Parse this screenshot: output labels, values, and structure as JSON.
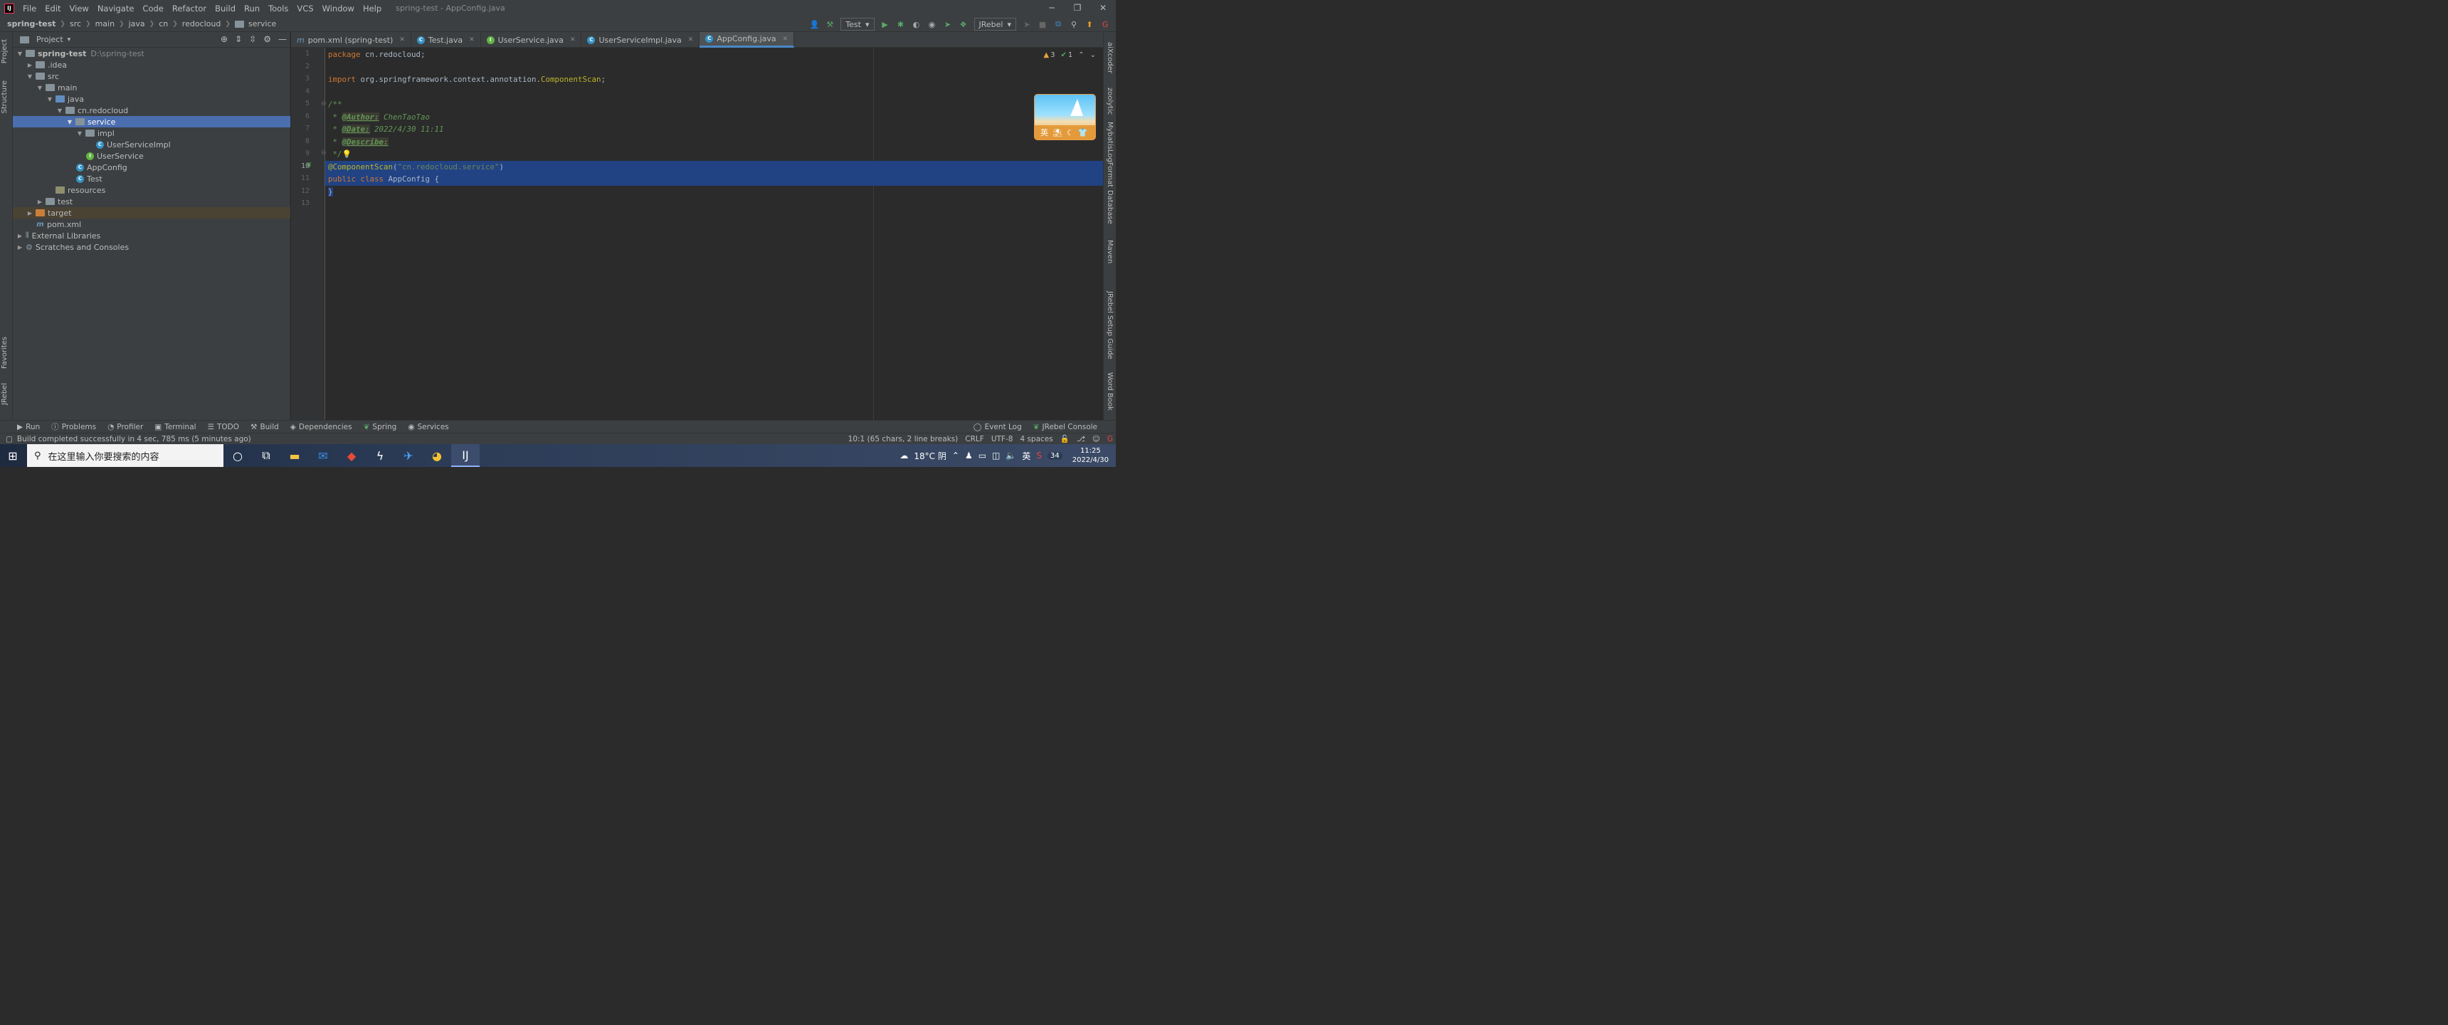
{
  "menubar": {
    "items": [
      "File",
      "Edit",
      "View",
      "Navigate",
      "Code",
      "Refactor",
      "Build",
      "Run",
      "Tools",
      "VCS",
      "Window",
      "Help"
    ],
    "title": "spring-test - AppConfig.java"
  },
  "navbar": {
    "crumbs": [
      "spring-test",
      "src",
      "main",
      "java",
      "cn",
      "redocloud",
      "service"
    ],
    "run_config": "Test",
    "jrebel_combo": "JRebel"
  },
  "left_strip": {
    "project": "Project",
    "structure": "Structure",
    "favorites": "Favorites",
    "jrebel": "JRebel"
  },
  "right_strip": {
    "aixcoder": "aiXcoder",
    "zoolytic": "zoolytic",
    "mybatis": "MybatisLogFormat",
    "database": "Database",
    "maven": "Maven",
    "jrebel_guide": "JRebel Setup Guide",
    "word_book": "Word Book"
  },
  "project": {
    "title": "Project",
    "tree": [
      {
        "label": "spring-test",
        "path": "D:\\spring-test",
        "bold": true
      },
      {
        "label": ".idea"
      },
      {
        "label": "src"
      },
      {
        "label": "main"
      },
      {
        "label": "java"
      },
      {
        "label": "cn.redocloud"
      },
      {
        "label": "service"
      },
      {
        "label": "impl"
      },
      {
        "label": "UserServiceImpl"
      },
      {
        "label": "UserService"
      },
      {
        "label": "AppConfig"
      },
      {
        "label": "Test"
      },
      {
        "label": "resources"
      },
      {
        "label": "test"
      },
      {
        "label": "target"
      },
      {
        "label": "pom.xml"
      },
      {
        "label": "External Libraries"
      },
      {
        "label": "Scratches and Consoles"
      }
    ]
  },
  "tabs": [
    {
      "label": "pom.xml (spring-test)",
      "icon": "m"
    },
    {
      "label": "Test.java",
      "icon": "c"
    },
    {
      "label": "UserService.java",
      "icon": "i"
    },
    {
      "label": "UserServiceImpl.java",
      "icon": "c"
    },
    {
      "label": "AppConfig.java",
      "icon": "c",
      "active": true
    }
  ],
  "editor": {
    "line_numbers": [
      "1",
      "2",
      "3",
      "4",
      "5",
      "6",
      "7",
      "8",
      "9",
      "10",
      "11",
      "12",
      "13"
    ],
    "pkg_kw": "package",
    "pkg_name": " cn.redocloud;",
    "imp_kw": "import",
    "imp_pkg": " org.springframework.context.annotation.",
    "imp_cls": "ComponentScan",
    "imp_end": ";",
    "doc_open": "/**",
    "doc_star": " * ",
    "author_tag": "@Author:",
    "author_val": " ChenTaoTao",
    "date_tag": "@Date:",
    "date_val": " 2022/4/30 11:11",
    "desc_tag": "@Describe:",
    "doc_close": " */",
    "ann_name": "@ComponentScan",
    "ann_arg": "\"cn.redocloud.service\"",
    "class_kw": "public class",
    "class_name": " AppConfig {",
    "close_brace": "}",
    "warnings": "3",
    "weak_warnings": "1"
  },
  "image_widget": {
    "label": "英"
  },
  "bottom_tools": [
    "Run",
    "Problems",
    "Profiler",
    "Terminal",
    "TODO",
    "Build",
    "Dependencies",
    "Spring",
    "Services"
  ],
  "bottom_right": [
    "Event Log",
    "JRebel Console"
  ],
  "status": {
    "message": "Build completed successfully in 4 sec, 785 ms (5 minutes ago)",
    "position": "10:1 (65 chars, 2 line breaks)",
    "line_sep": "CRLF",
    "encoding": "UTF-8",
    "indent": "4 spaces"
  },
  "taskbar": {
    "search_placeholder": "在这里输入你要搜索的内容",
    "weather": "18°C 阴",
    "ime": "英",
    "time": "11:25",
    "date": "2022/4/30",
    "notify_count": "34"
  },
  "colors": {
    "selection": "#4b6eaf",
    "editor_bg": "#2b2b2b",
    "highlight": "#214283",
    "accent": "#4a88c7"
  }
}
